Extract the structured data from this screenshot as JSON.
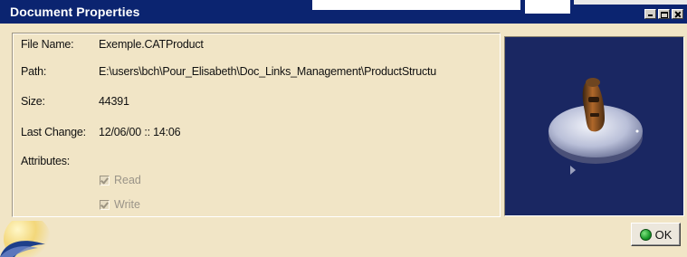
{
  "window": {
    "title": "Document Properties"
  },
  "properties": {
    "file_name_label": "File Name:",
    "file_name_value": "Exemple.CATProduct",
    "path_label": "Path:",
    "path_value": "E:\\users\\bch\\Pour_Elisabeth\\Doc_Links_Management\\ProductStructu",
    "size_label": "Size:",
    "size_value": "44391",
    "last_change_label": "Last Change:",
    "last_change_value": "12/06/00 :: 14:06",
    "attributes_label": "Attributes:",
    "attributes": [
      {
        "label": "Read",
        "checked": true,
        "enabled": false
      },
      {
        "label": "Write",
        "checked": true,
        "enabled": false
      }
    ]
  },
  "buttons": {
    "ok_label": "OK"
  },
  "icons": {
    "ok": "ok-check-icon",
    "minimize": "minimize-icon",
    "maximize": "maximize-icon",
    "close": "close-icon",
    "logo": "catia-logo-icon"
  },
  "colors": {
    "title_bar": "#0b2470",
    "dialog_background": "#f1e5c6",
    "preview_background": "#1a2762",
    "disabled_text": "#9a9488"
  }
}
